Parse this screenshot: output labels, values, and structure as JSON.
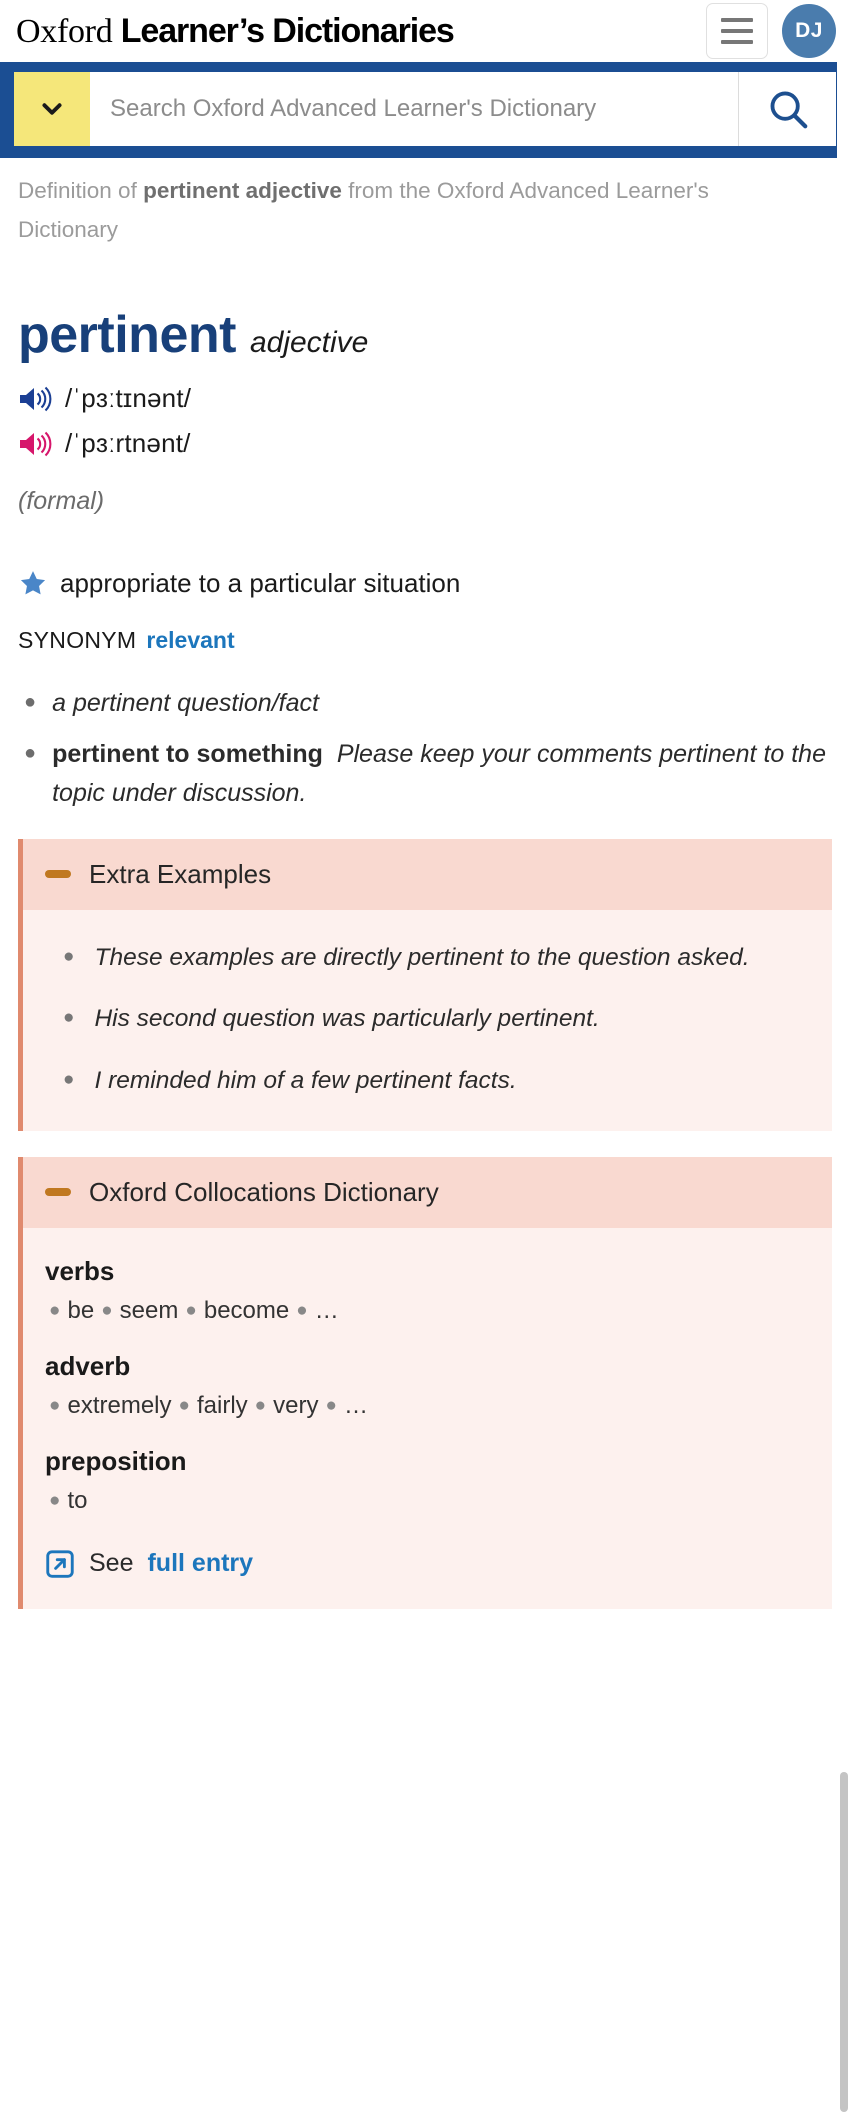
{
  "header": {
    "logo_serif": "Oxford",
    "logo_bold": " Learner’s Dictionaries",
    "menu_icon": "hamburger-menu-icon",
    "avatar_initials": "DJ"
  },
  "search": {
    "lang_icon": "chevron-down-icon",
    "placeholder": "Search Oxford Advanced Learner's Dictionary",
    "value": "",
    "search_icon": "search-icon"
  },
  "breadcrumb": {
    "prefix": "Definition of ",
    "bold": "pertinent adjective",
    "suffix": " from the Oxford Advanced Learner's Dictionary"
  },
  "entry": {
    "headword": "pertinent",
    "part_of_speech": "adjective",
    "pronunciations": [
      {
        "region": "uk",
        "icon": "speaker-icon",
        "ipa": "/ˈpɜːtɪnənt/",
        "color": "#1b3f94"
      },
      {
        "region": "us",
        "icon": "speaker-icon",
        "ipa": "/ˈpɜːrtnənt/",
        "color": "#d6166b"
      }
    ],
    "register": "(formal)",
    "star_icon": "star-icon",
    "definition": "appropriate to a particular situation",
    "synonym_label": "SYNONYM",
    "synonym_word": "relevant",
    "examples": [
      {
        "cf": "",
        "text": "a pertinent question/fact"
      },
      {
        "cf": "pertinent to something",
        "text": "Please keep your comments pertinent to the topic under discussion."
      }
    ]
  },
  "extra_examples": {
    "toggle_icon": "minus-icon",
    "title": "Extra Examples",
    "items": [
      "These examples are directly pertinent to the question asked.",
      "His second question was particularly pertinent.",
      "I reminded him of a few pertinent facts."
    ]
  },
  "collocations": {
    "toggle_icon": "minus-icon",
    "title": "Oxford Collocations Dictionary",
    "groups": [
      {
        "label": "verbs",
        "words": [
          "be",
          "seem",
          "become",
          "…"
        ]
      },
      {
        "label": "adverb",
        "words": [
          "extremely",
          "fairly",
          "very",
          "…"
        ]
      },
      {
        "label": "preposition",
        "words": [
          "to"
        ]
      }
    ],
    "full_entry_icon": "external-link-icon",
    "full_entry_prefix": "See ",
    "full_entry_link": "full entry"
  },
  "colors": {
    "brand_blue": "#1b4e93",
    "headword_blue": "#18407a",
    "link_blue": "#1c76bc",
    "panel_head": "#f9d9d0",
    "panel_body": "#fdf1ee",
    "panel_border": "#e08a6e",
    "yellow": "#f5e77a",
    "avatar": "#4a7cad"
  }
}
